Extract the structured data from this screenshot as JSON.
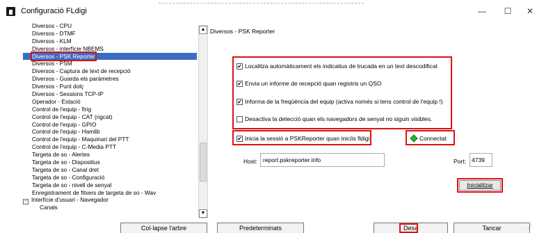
{
  "window": {
    "title": "Configuració FLdigi",
    "minimize_icon": "minimize-icon",
    "maximize_icon": "maximize-icon",
    "close_icon": "close-icon",
    "minimize_glyph": "—",
    "maximize_glyph": "☐",
    "close_glyph": "✕"
  },
  "tree": {
    "items": [
      {
        "label": "Diversos - CPU",
        "kind": "item"
      },
      {
        "label": "Diversos - DTMF",
        "kind": "item"
      },
      {
        "label": "Diversos - KLM",
        "kind": "item"
      },
      {
        "label": "Diversos - interfície NBEMS",
        "kind": "item"
      },
      {
        "label": "Diversos - PSK Reporter",
        "kind": "selected"
      },
      {
        "label": "Diversos - PSM",
        "kind": "item"
      },
      {
        "label": "Diversos - Captura de text de recepció",
        "kind": "item"
      },
      {
        "label": "Diversos - Guarda els paràmetres",
        "kind": "item"
      },
      {
        "label": "Diversos - Punt dolç",
        "kind": "item"
      },
      {
        "label": "Diversos - Sessions TCP-IP",
        "kind": "item"
      },
      {
        "label": "Operador - Estació",
        "kind": "item"
      },
      {
        "label": "Control de l'equip - flrig",
        "kind": "item"
      },
      {
        "label": "Control de l'equip - CAT (rigcat)",
        "kind": "item"
      },
      {
        "label": "Control de l'equip - GPIO",
        "kind": "item"
      },
      {
        "label": "Control de l'equip - Hamlib",
        "kind": "item"
      },
      {
        "label": "Control de l'equip - Maquinari del PTT",
        "kind": "item"
      },
      {
        "label": "Control de l'equip - C-Media PTT",
        "kind": "item"
      },
      {
        "label": "Targeta de so - Alertes",
        "kind": "item"
      },
      {
        "label": "Targeta de so - Dispositius",
        "kind": "item"
      },
      {
        "label": "Targeta de so - Canal dret",
        "kind": "item"
      },
      {
        "label": "Targeta de so - Configuració",
        "kind": "item"
      },
      {
        "label": "Targeta de so - nivell de senyal",
        "kind": "item"
      },
      {
        "label": "Enregistrament de fitxers de targeta de so - Wav",
        "kind": "item"
      },
      {
        "label": "Interfície d'usuari - Navegador",
        "kind": "group"
      },
      {
        "label": "Canals",
        "kind": "child"
      }
    ],
    "expander_glyph": "−"
  },
  "scrollbar": {
    "up_glyph": "▲",
    "down_glyph": "▼"
  },
  "panel": {
    "title": "Diversos - PSK Reporter",
    "options": [
      {
        "label": "Localitza automàticament els indicatius de trucada en un text descodificat",
        "checked": true
      },
      {
        "label": "Envia un informe de recepció quan registris un QSO",
        "checked": true
      },
      {
        "label": "Informa de la freqüència del equip (activa només si tens control de l'equip !)",
        "checked": true
      },
      {
        "label": "Desactiva la detecció quan els navegadors de senyal no siguin visibles.",
        "checked": false
      }
    ],
    "login_option": {
      "label": "Inicia la sessió a PSKReporter quan iniciïs fldigi",
      "checked": true
    },
    "check_glyph": "✔",
    "status": {
      "label": "Connectat",
      "color": "#2fb52f"
    },
    "host": {
      "label": "Host:",
      "value": "report.pskreporter.info"
    },
    "port": {
      "label": "Port:",
      "value": "4739"
    },
    "init_button": "Inicialitzar"
  },
  "footer": {
    "collapse": "Col·lapse l'arbre",
    "defaults": "Predeterminats",
    "save": "Desa",
    "close": "Tancar"
  },
  "colors": {
    "accent_red": "#e01010",
    "selection": "#3b6cc5"
  }
}
